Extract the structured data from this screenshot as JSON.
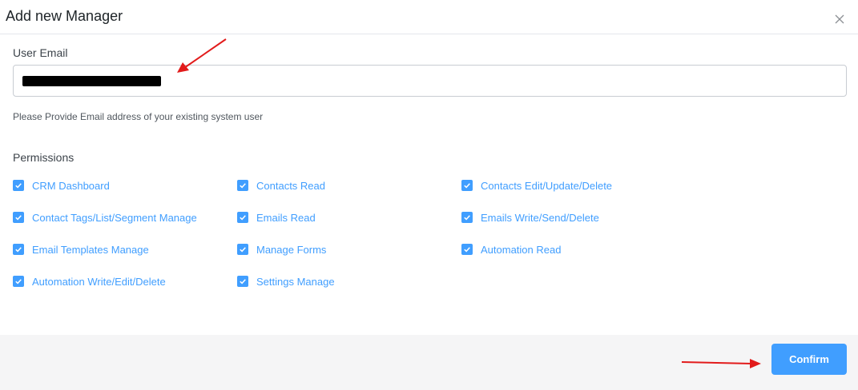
{
  "modal": {
    "title": "Add new Manager",
    "close_icon": "close-icon"
  },
  "email": {
    "label": "User Email",
    "value": "",
    "value_redacted": true,
    "help_text": "Please Provide Email address of your existing system user"
  },
  "permissions": {
    "label": "Permissions",
    "items": [
      {
        "label": "CRM Dashboard",
        "checked": true
      },
      {
        "label": "Contacts Read",
        "checked": true
      },
      {
        "label": "Contacts Edit/Update/Delete",
        "checked": true
      },
      {
        "label": "Contact Tags/List/Segment Manage",
        "checked": true
      },
      {
        "label": "Emails Read",
        "checked": true
      },
      {
        "label": "Emails Write/Send/Delete",
        "checked": true
      },
      {
        "label": "Email Templates Manage",
        "checked": true
      },
      {
        "label": "Manage Forms",
        "checked": true
      },
      {
        "label": "Automation Read",
        "checked": true
      },
      {
        "label": "Automation Write/Edit/Delete",
        "checked": true
      },
      {
        "label": "Settings Manage",
        "checked": true
      }
    ]
  },
  "footer": {
    "confirm_label": "Confirm"
  },
  "colors": {
    "accent": "#409eff",
    "annotation_arrow": "#e21b1b",
    "footer_bg": "#f5f5f6"
  }
}
